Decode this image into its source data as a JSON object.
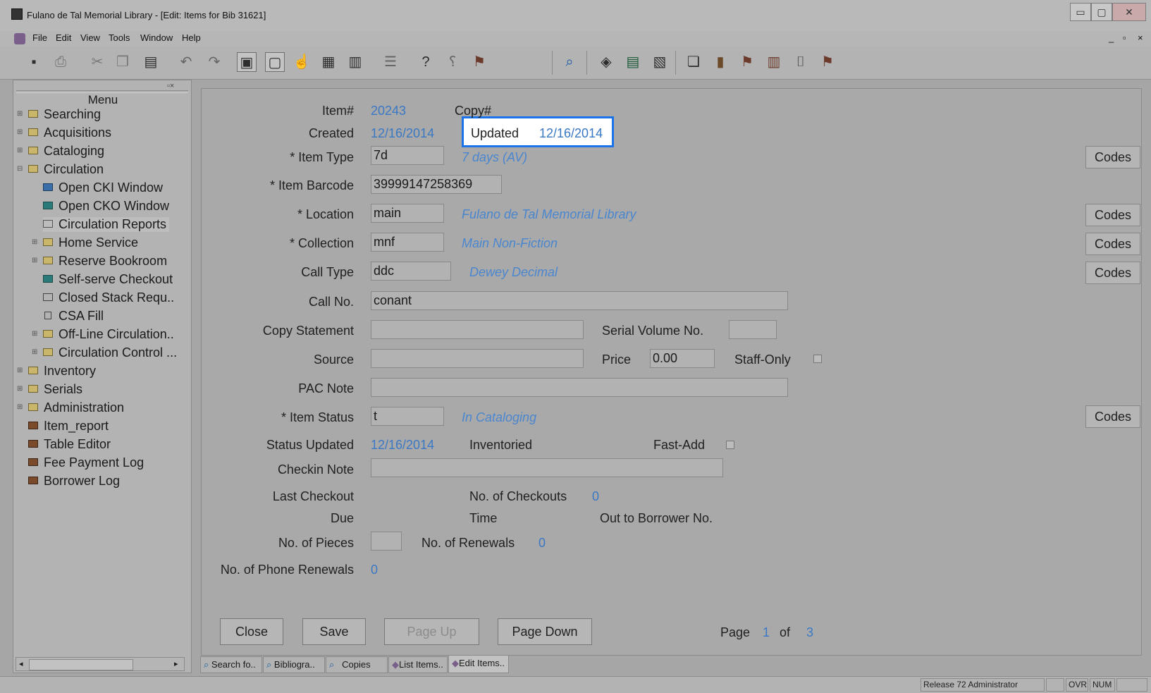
{
  "window": {
    "title": "Fulano de Tal Memorial Library - [Edit: Items for Bib 31621]",
    "minimize": "▭",
    "maximize": "▢",
    "close": "✕",
    "mdi_min": "_",
    "mdi_restore": "▫",
    "mdi_close": "×"
  },
  "menubar": [
    "File",
    "Edit",
    "View",
    "Tools",
    "Window",
    "Help"
  ],
  "toolbar": {
    "icons": [
      "save-icon",
      "print-icon",
      "cut-icon",
      "copy-icon",
      "paste-icon",
      "undo-icon",
      "redo-icon",
      "window-icon",
      "window-alt-icon",
      "hand-icon",
      "grid-icon",
      "form-icon",
      "list-icon",
      "help-icon",
      "context-help-icon",
      "chart-icon",
      "search-icon",
      "cko-icon",
      "barcode-icon",
      "report-icon",
      "book-search-icon",
      "bookshelf-icon",
      "chart-icon",
      "chart-bars-icon",
      "bin-icon",
      "chart-icon"
    ]
  },
  "menu": {
    "header": "Menu",
    "items": [
      {
        "label": "Searching"
      },
      {
        "label": "Acquisitions"
      },
      {
        "label": "Cataloging"
      },
      {
        "label": "Circulation"
      },
      {
        "label": "Open CKI Window"
      },
      {
        "label": "Open CKO Window"
      },
      {
        "label": "Circulation Reports"
      },
      {
        "label": "Home Service"
      },
      {
        "label": "Reserve Bookroom"
      },
      {
        "label": "Self-serve Checkout"
      },
      {
        "label": "Closed Stack Requ.."
      },
      {
        "label": "CSA Fill"
      },
      {
        "label": "Off-Line Circulation.."
      },
      {
        "label": "Circulation Control ..."
      },
      {
        "label": "Inventory"
      },
      {
        "label": "Serials"
      },
      {
        "label": "Administration"
      },
      {
        "label": "Item_report"
      },
      {
        "label": "Table Editor"
      },
      {
        "label": "Fee Payment Log"
      },
      {
        "label": "Borrower Log"
      }
    ]
  },
  "form": {
    "item_no_label": "Item#",
    "item_no": "20243",
    "copy_no_label": "Copy#",
    "created_label": "Created",
    "created": "12/16/2014",
    "updated_label": "Updated",
    "updated": "12/16/2014",
    "item_type_label": "* Item Type",
    "item_type": "7d",
    "item_type_desc": "7 days (AV)",
    "barcode_label": "* Item Barcode",
    "barcode": "39999147258369",
    "location_label": "* Location",
    "location": "main",
    "location_desc": "Fulano de Tal Memorial Library",
    "collection_label": "* Collection",
    "collection": "mnf",
    "collection_desc": "Main Non-Fiction",
    "call_type_label": "Call Type",
    "call_type": "ddc",
    "call_type_desc": "Dewey Decimal",
    "call_no_label": "Call No.",
    "call_no": "conant",
    "copy_statement_label": "Copy Statement",
    "copy_statement": "",
    "serial_volume_label": "Serial Volume No.",
    "serial_volume": "",
    "source_label": "Source",
    "source": "",
    "price_label": "Price",
    "price": "0.00",
    "staff_only_label": "Staff-Only",
    "pac_note_label": "PAC Note",
    "pac_note": "",
    "item_status_label": "* Item Status",
    "item_status": "t",
    "item_status_desc": "In Cataloging",
    "status_updated_label": "Status Updated",
    "status_updated": "12/16/2014",
    "inventoried_label": "Inventoried",
    "fast_add_label": "Fast-Add",
    "checkin_note_label": "Checkin Note",
    "checkin_note": "",
    "last_checkout_label": "Last Checkout",
    "checkouts_label": "No. of Checkouts",
    "checkouts": "0",
    "due_label": "Due",
    "time_label": "Time",
    "out_to_label": "Out to Borrower No.",
    "pieces_label": "No. of Pieces",
    "pieces": "",
    "renewals_label": "No. of Renewals",
    "renewals": "0",
    "phone_renewals_label": "No. of Phone Renewals",
    "phone_renewals": "0",
    "codes_label": "Codes",
    "close_label": "Close",
    "save_label": "Save",
    "page_up_label": "Page Up",
    "page_down_label": "Page Down",
    "page_label": "Page",
    "page": "1",
    "of_label": "of",
    "pages": "3"
  },
  "tabs": [
    "Search fo..",
    "Bibliogra..",
    "Copies",
    "List Items..",
    "Edit Items.."
  ],
  "status": {
    "release": "Release 72 Administrator",
    "ovr": "OVR",
    "num": "NUM"
  },
  "colors": {
    "accent": "#1a73e8",
    "link_value": "#3a78c4"
  }
}
